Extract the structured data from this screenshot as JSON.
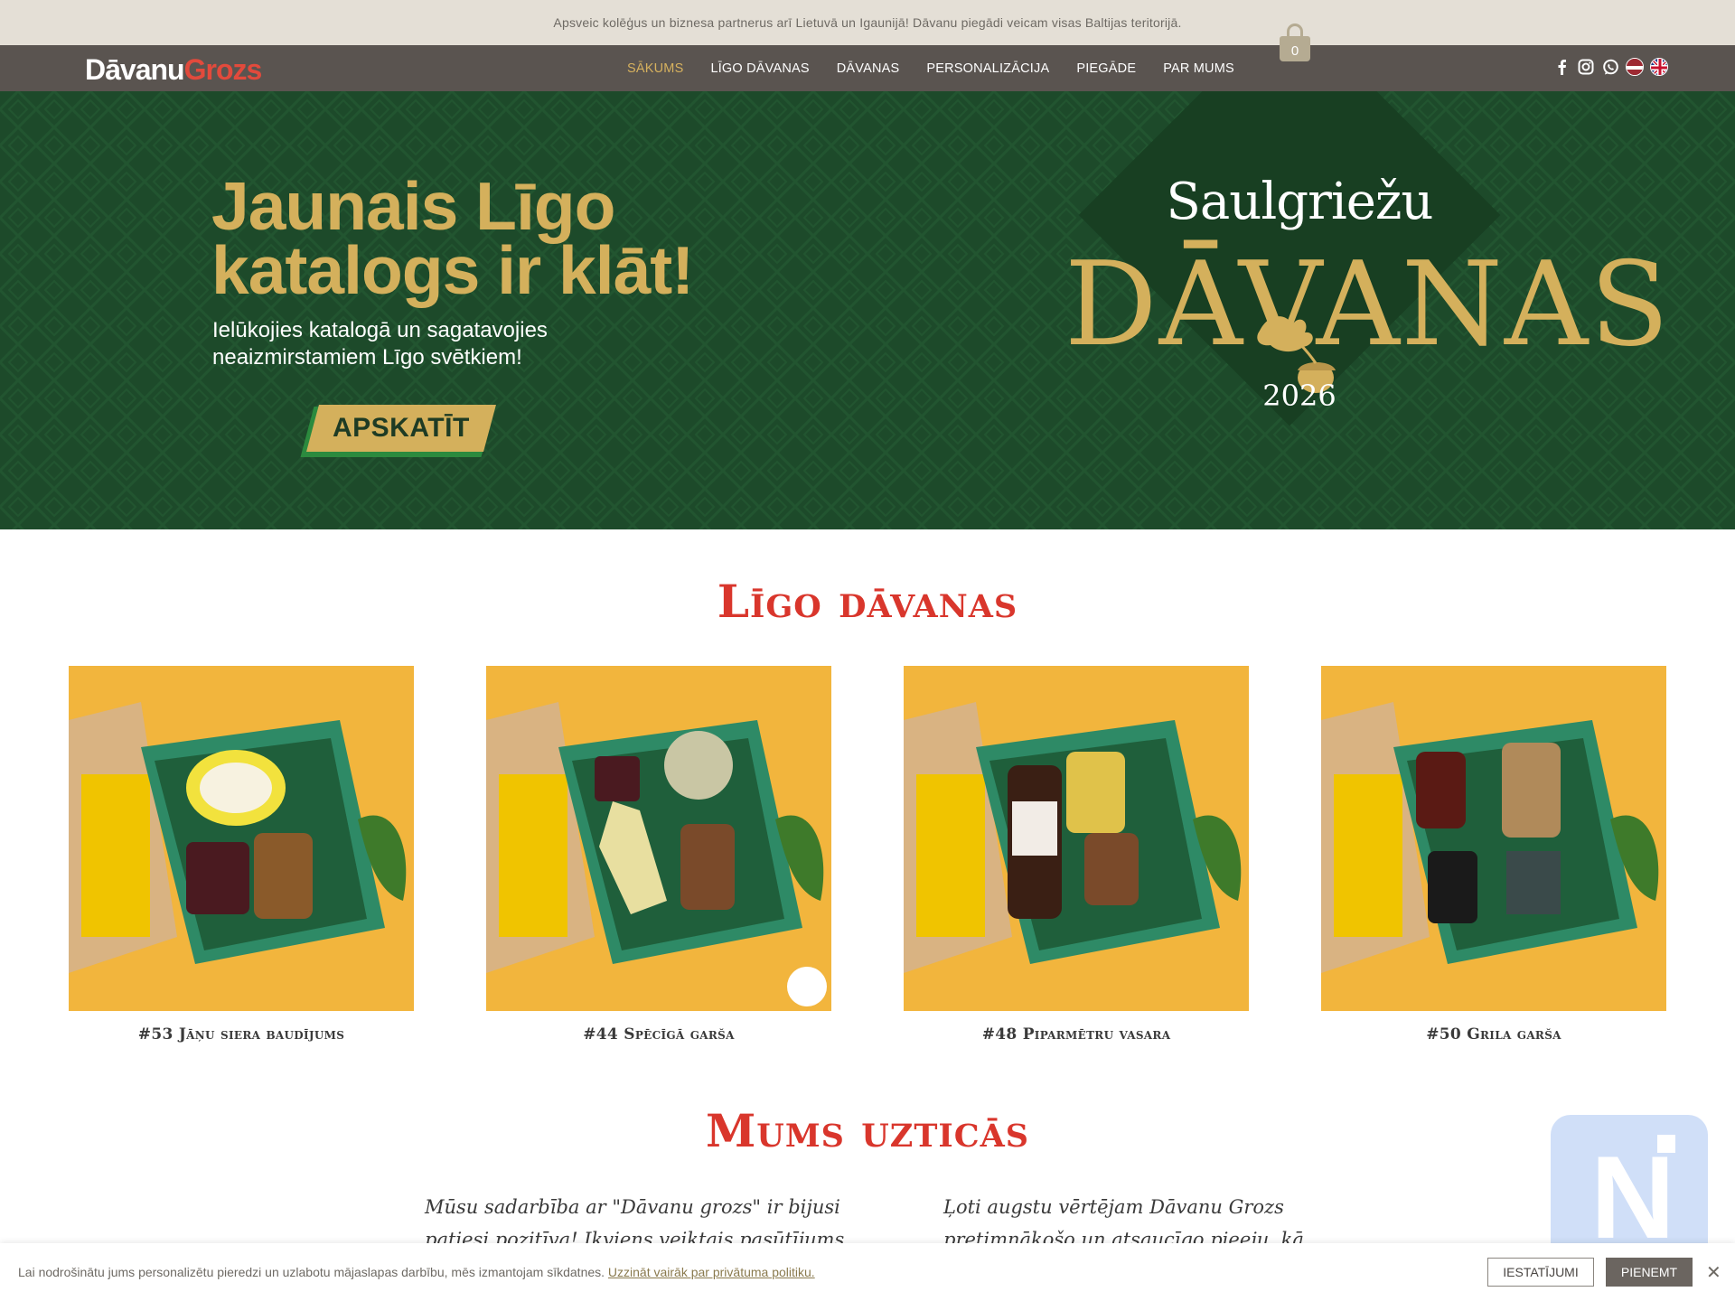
{
  "announcement": "Apsveic kolēģus un biznesa partnerus arī Lietuvā un Igaunijā! Dāvanu piegādi veicam visas Baltijas teritorijā.",
  "logo": {
    "part1": "Dāvanu",
    "part2": "Grozs"
  },
  "nav": {
    "items": [
      {
        "label": "SĀKUMS",
        "active": true
      },
      {
        "label": "LĪGO DĀVANAS"
      },
      {
        "label": "DĀVANAS"
      },
      {
        "label": "PERSONALIZĀCIJA"
      },
      {
        "label": "PIEGĀDE"
      },
      {
        "label": "PAR MUMS"
      }
    ],
    "cart_count": "0",
    "social_icons": [
      "facebook-icon",
      "instagram-icon",
      "whatsapp-icon"
    ],
    "languages": [
      "latvian-flag-icon",
      "uk-flag-icon"
    ]
  },
  "hero": {
    "title_line1": "Jaunais Līgo",
    "title_line2": "katalogs ir klāt!",
    "subtitle_line1": "Ielūkojies katalogā un sagatavojies",
    "subtitle_line2": "neaizmirstamiem Līgo svētkiem!",
    "button": "APSKATĪT",
    "badge_top": "Saulgriežu",
    "badge_main": "DĀVANAS",
    "badge_year": "2026"
  },
  "colors": {
    "accent_gold": "#d4b05c",
    "hero_green": "#1d4a2a",
    "title_red": "#d9362c",
    "nav_bg": "#5a5450"
  },
  "products_section": {
    "title": "Līgo dāvanas",
    "items": [
      {
        "name": "#53 Jāņu siera baudījums"
      },
      {
        "name": "#44 Spēcīgā garša"
      },
      {
        "name": "#48 Piparmētru vasara"
      },
      {
        "name": "#50 Grila garša"
      }
    ]
  },
  "trust_section": {
    "title": "Mums uzticās",
    "quotes": [
      {
        "line1": "Mūsu sadarbība ar \"Dāvanu grozs\" ir bijusi",
        "line2": "patiesi pozitīva! Ikviens veiktais pasūtījums allaž"
      },
      {
        "line1": "Ļoti augstu vērtējam Dāvanu Grozs",
        "line2": "pretimnākošo un atsaucīgo pieeju, kā"
      }
    ]
  },
  "cookie": {
    "text": "Lai nodrošinātu jums personalizētu pieredzi un uzlabotu mājaslapas darbību, mēs izmantojam sīkdatnes.",
    "link": "Uzzināt vairāk par privātuma politiku.",
    "settings_button": "IESTATĪJUMI",
    "accept_button": "PIENEMT",
    "close": "✕"
  }
}
